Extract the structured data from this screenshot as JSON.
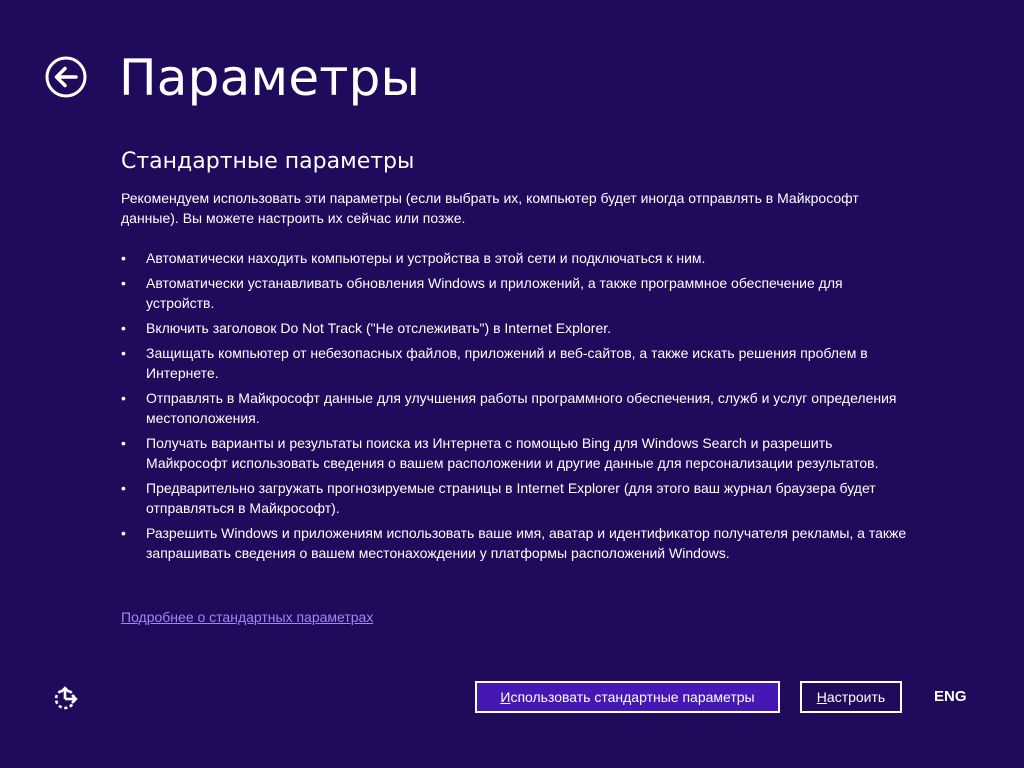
{
  "header": {
    "title": "Параметры",
    "back_icon": "back-arrow-icon"
  },
  "main": {
    "section_title": "Стандартные параметры",
    "intro": "Рекомендуем использовать эти параметры (если выбрать их, компьютер будет иногда отправлять в Майкрософт данные). Вы можете настроить их сейчас или позже.",
    "bullet_char": "•",
    "bullets": [
      "Автоматически находить компьютеры и устройства в этой сети и подключаться к ним.",
      "Автоматически устанавливать обновления Windows и приложений, а также программное обеспечение для устройств.",
      "Включить заголовок Do Not Track (\"Не отслеживать\") в Internet Explorer.",
      "Защищать компьютер от небезопасных файлов, приложений и веб-сайтов, а также искать решения проблем в Интернете.",
      "Отправлять в Майкрософт данные для улучшения работы программного обеспечения, служб и услуг определения местоположения.",
      "Получать варианты и результаты поиска из Интернета с помощью Bing для Windows Search и разрешить Майкрософт использовать сведения о вашем расположении и другие данные для персонализации результатов.",
      "Предварительно загружать прогнозируемые страницы в Internet Explorer (для этого ваш журнал браузера будет отправляться в Майкрософт).",
      "Разрешить Windows и приложениям использовать ваше имя, аватар и идентификатор получателя рекламы, а также запрашивать сведения о вашем местонахождении у платформы расположений Windows."
    ],
    "learn_more_link": "Подробнее о стандартных параметрах"
  },
  "footer": {
    "ease_of_access_icon": "ease-of-access-icon",
    "primary_button": {
      "accel": "И",
      "rest": "спользовать стандартные параметры"
    },
    "secondary_button": {
      "accel": "Н",
      "rest": "астроить"
    },
    "language": "ENG"
  },
  "colors": {
    "background": "#1f0a5c",
    "primary_button_bg": "#4617b4",
    "link": "#a487f2",
    "text": "#ffffff"
  }
}
